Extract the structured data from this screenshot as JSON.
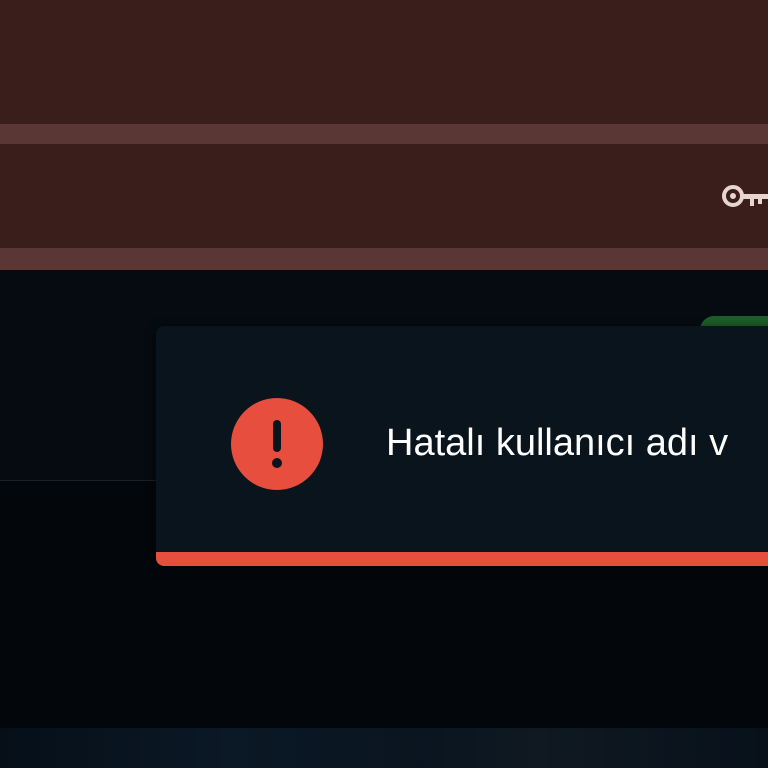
{
  "colors": {
    "header_bg": "#3a1e1c",
    "header_stripe": "#5a3634",
    "page_bg": "#02060b",
    "toast_bg": "#0a141d",
    "error_accent": "#e84e3d",
    "success_accent": "#1d5e2b",
    "toast_text": "#ffffff"
  },
  "header": {
    "key_icon": "key-icon"
  },
  "toast": {
    "type": "error",
    "icon": "exclamation-circle-icon",
    "message": "Hatalı kullanıcı adı v"
  }
}
